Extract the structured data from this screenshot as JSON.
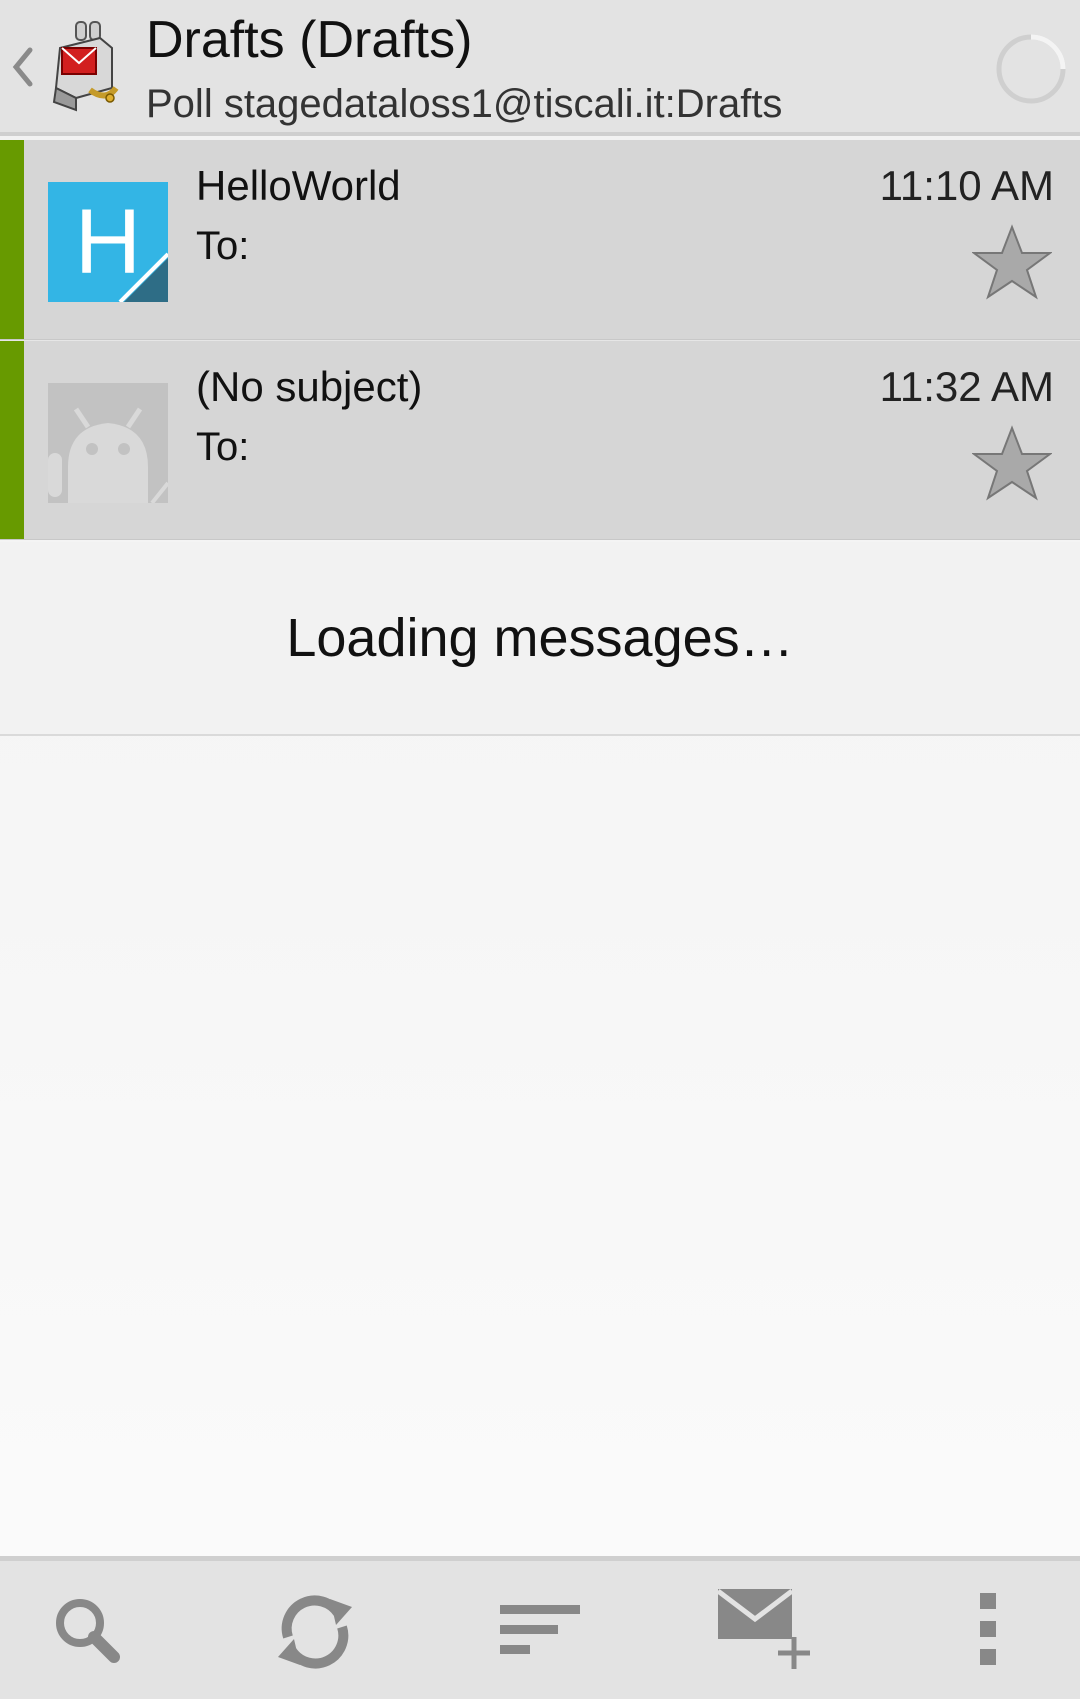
{
  "colors": {
    "actionbar_bg": "#e3e3e3",
    "row_bg": "#d6d6d6",
    "unread_bar": "#679a00",
    "avatar_blue": "#33b5e5",
    "icon_gray": "#888888"
  },
  "actionbar": {
    "up_icon": "chevron-left-icon",
    "app_icon": "k9-mail-dog-icon",
    "title": "Drafts (Drafts)",
    "subtitle": "Poll stagedataloss1@tiscali.it:Drafts",
    "progress_icon": "loading-spinner-icon"
  },
  "messages": [
    {
      "subject": "HelloWorld",
      "to": "To:",
      "time": "11:10 AM",
      "avatar_letter": "H",
      "avatar_type": "letter",
      "starred": false
    },
    {
      "subject": "(No subject)",
      "to": "To:",
      "time": "11:32 AM",
      "avatar_type": "android-placeholder-icon",
      "starred": false
    }
  ],
  "footer": {
    "loading_text": "Loading messages…"
  },
  "bottombar": {
    "buttons": [
      {
        "icon": "search-icon"
      },
      {
        "icon": "refresh-icon"
      },
      {
        "icon": "sort-icon"
      },
      {
        "icon": "compose-mail-icon"
      },
      {
        "icon": "overflow-menu-icon"
      }
    ]
  }
}
